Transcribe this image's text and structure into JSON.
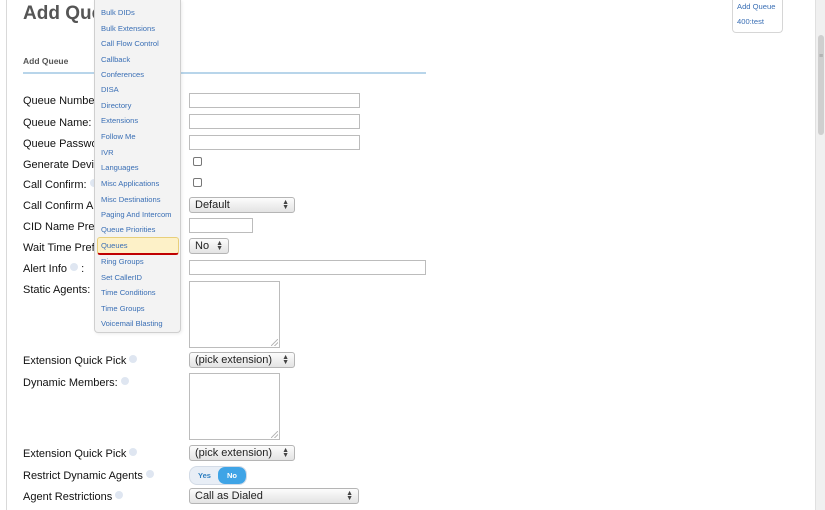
{
  "page": {
    "title": "Add Queue",
    "section_label": "Add Queue"
  },
  "menu": {
    "items": [
      "Bulk DIDs",
      "Bulk Extensions",
      "Call Flow Control",
      "Callback",
      "Conferences",
      "DISA",
      "Directory",
      "Extensions",
      "Follow Me",
      "IVR",
      "Languages",
      "Misc Applications",
      "Misc Destinations",
      "Paging And Intercom",
      "Queue Priorities",
      "Queues",
      "Ring Groups",
      "Set CallerID",
      "Time Conditions",
      "Time Groups",
      "Voicemail Blasting"
    ],
    "active": "Queues"
  },
  "right_nav": {
    "add_queue": "Add Queue",
    "queue_item": "400:test"
  },
  "form": {
    "queue_number": "Queue Number",
    "queue_name": "Queue Name:",
    "queue_password": "Queue Passwo",
    "generate_device": "Generate Devic",
    "call_confirm": "Call Confirm:",
    "call_confirm_announce": "Call Confirm An",
    "cid_name_prefix": "CID Name Pre",
    "wait_time_prefix": "Wait Time Pref",
    "alert_info": "Alert Info",
    "alert_info_colon": ":",
    "static_agents": "Static Agents:",
    "extension_quick_pick_1": "Extension Quick Pick",
    "dynamic_members": "Dynamic Members:",
    "extension_quick_pick_2": "Extension Quick Pick",
    "restrict_dynamic_agents": "Restrict Dynamic Agents",
    "agent_restrictions": "Agent Restrictions"
  },
  "values": {
    "call_confirm_announce_select": "Default",
    "wait_time_prefix_select": "No",
    "extension_quick_pick_1_select": "(pick extension)",
    "extension_quick_pick_2_select": "(pick extension)",
    "restrict_toggle_yes": "Yes",
    "restrict_toggle_no": "No",
    "restrict_selected": "No",
    "agent_restrictions_select": "Call as Dialed"
  }
}
